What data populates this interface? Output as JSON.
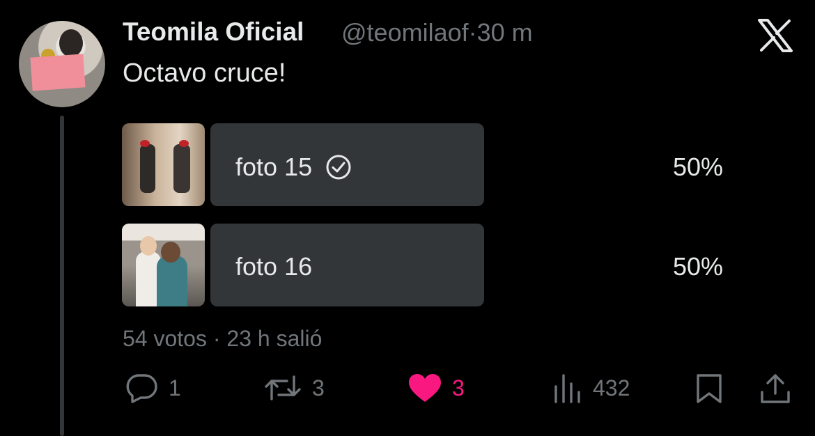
{
  "tweet": {
    "author_name": "Teomila Oficial",
    "author_handle": "@teomilaof",
    "separator": "·",
    "time": "30 m",
    "text": "Octavo cruce!"
  },
  "poll": {
    "options": [
      {
        "label": "foto 15",
        "percent": "50%",
        "selected": true
      },
      {
        "label": "foto 16",
        "percent": "50%",
        "selected": false
      }
    ],
    "votes": "54 votos",
    "separator": "·",
    "status": "23 h salió"
  },
  "actions": {
    "reply_count": "1",
    "repost_count": "3",
    "like_count": "3",
    "views_count": "432"
  },
  "icons": {
    "logo": "x-logo-icon",
    "check": "check-circle-icon",
    "reply": "reply-icon",
    "repost": "repost-icon",
    "like": "heart-icon",
    "views": "views-icon",
    "bookmark": "bookmark-icon",
    "share": "share-icon"
  },
  "colors": {
    "background": "#000000",
    "text": "#e7e9ea",
    "muted": "#71767b",
    "poll_bar": "#333639",
    "like": "#f91880"
  }
}
